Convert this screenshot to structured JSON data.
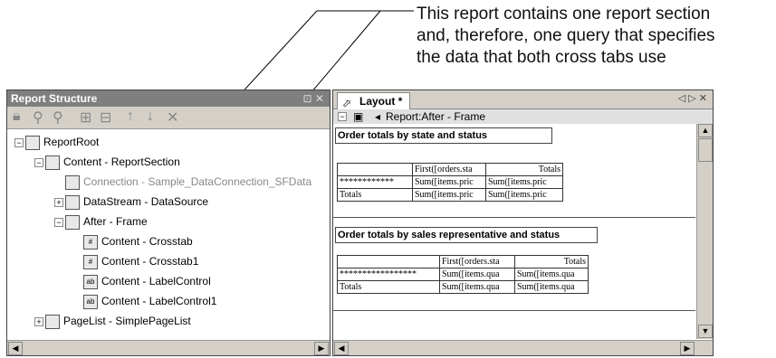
{
  "annotation": "This report contains one report section\nand, therefore, one query that specifies\nthe data that both cross tabs use",
  "left_panel": {
    "title": "Report Structure",
    "tree": [
      {
        "label": "ReportRoot",
        "icon": "report-root-icon"
      },
      {
        "label": "Content - ReportSection",
        "icon": "report-section-icon"
      },
      {
        "label": "Connection - Sample_DataConnection_SFData",
        "icon": "connection-icon"
      },
      {
        "label": "DataStream - DataSource",
        "icon": "datastream-icon"
      },
      {
        "label": "After - Frame",
        "icon": "frame-icon"
      },
      {
        "label": "Content - Crosstab",
        "icon": "crosstab-icon"
      },
      {
        "label": "Content - Crosstab1",
        "icon": "crosstab-icon"
      },
      {
        "label": "Content - LabelControl",
        "icon": "label-control-icon"
      },
      {
        "label": "Content - LabelControl1",
        "icon": "label-control-icon"
      },
      {
        "label": "PageList - SimplePageList",
        "icon": "pagelist-icon"
      }
    ]
  },
  "right_panel": {
    "tab": "Layout *",
    "frame_label": "Report:After - Frame",
    "label1": "Order totals by state and status",
    "label2": "Order totals by sales representative and status",
    "crosstab1": [
      [
        "",
        "First([orders.sta",
        "Totals"
      ],
      [
        "************",
        "Sum([items.pric",
        "Sum([items.pric"
      ],
      [
        "Totals",
        "Sum([items.pric",
        "Sum([items.pric"
      ]
    ],
    "crosstab2": [
      [
        "",
        "First([orders.sta",
        "Totals"
      ],
      [
        "*****************",
        "Sum([items.qua",
        "Sum([items.qua"
      ],
      [
        "Totals",
        "Sum([items.qua",
        "Sum([items.qua"
      ]
    ]
  }
}
